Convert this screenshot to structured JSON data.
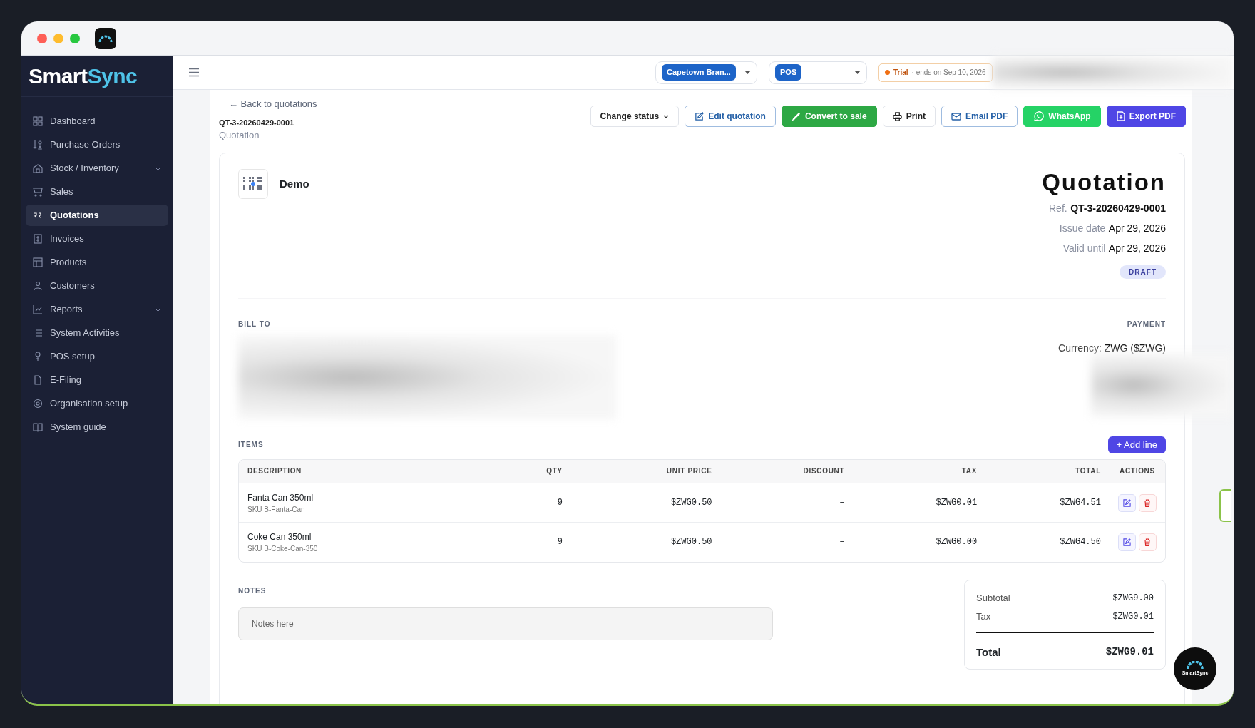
{
  "sidebar": {
    "logo": {
      "first": "Smart",
      "second": "Sync"
    },
    "items": [
      {
        "label": "Dashboard",
        "selected": false,
        "expandable": false
      },
      {
        "label": "Purchase Orders",
        "selected": false,
        "expandable": false
      },
      {
        "label": "Stock / Inventory",
        "selected": false,
        "expandable": true
      },
      {
        "label": "Sales",
        "selected": false,
        "expandable": false
      },
      {
        "label": "Quotations",
        "selected": true,
        "expandable": false
      },
      {
        "label": "Invoices",
        "selected": false,
        "expandable": false
      },
      {
        "label": "Products",
        "selected": false,
        "expandable": false
      },
      {
        "label": "Customers",
        "selected": false,
        "expandable": false
      },
      {
        "label": "Reports",
        "selected": false,
        "expandable": true
      },
      {
        "label": "System Activities",
        "selected": false,
        "expandable": false
      },
      {
        "label": "POS setup",
        "selected": false,
        "expandable": false
      },
      {
        "label": "E-Filing",
        "selected": false,
        "expandable": false
      },
      {
        "label": "Organisation setup",
        "selected": false,
        "expandable": false
      },
      {
        "label": "System guide",
        "selected": false,
        "expandable": false
      }
    ]
  },
  "header": {
    "branch": "Capetown Bran...",
    "register": "POS",
    "trial": {
      "label": "Trial",
      "text": "· ends on Sep 10, 2026"
    }
  },
  "page": {
    "back_link": "← Back to quotations",
    "number": "QT-3-20260429-0001",
    "subtitle": "Quotation"
  },
  "actions": [
    {
      "label": "Change status",
      "kind": "dropdown"
    },
    {
      "label": "Edit quotation",
      "kind": "outline"
    },
    {
      "label": "Convert to sale",
      "kind": "success"
    },
    {
      "label": "Print",
      "kind": "light"
    },
    {
      "label": "Email PDF",
      "kind": "outline"
    },
    {
      "label": "WhatsApp",
      "kind": "whatsapp"
    },
    {
      "label": "Export PDF",
      "kind": "primary"
    }
  ],
  "document": {
    "company": "Demo",
    "title": "Quotation",
    "ref_label": "Ref.",
    "ref": "QT-3-20260429-0001",
    "meta": [
      {
        "label": "Issue date",
        "value": "Apr 29, 2026"
      },
      {
        "label": "Valid until",
        "value": "Apr 29, 2026"
      }
    ],
    "status": "DRAFT",
    "bill_to_label": "BILL TO",
    "payment_label": "PAYMENT",
    "currency_label": "Currency:",
    "currency": "ZWG ($ZWG)"
  },
  "items": {
    "label": "ITEMS",
    "add_button": "+ Add line",
    "columns": [
      "DESCRIPTION",
      "QTY",
      "UNIT PRICE",
      "DISCOUNT",
      "TAX",
      "TOTAL",
      "ACTIONS"
    ],
    "rows": [
      {
        "description": "Fanta Can 350ml",
        "sku": "SKU B-Fanta-Can",
        "qty": "9",
        "unit_price": "$ZWG0.50",
        "discount": "–",
        "tax": "$ZWG0.01",
        "total": "$ZWG4.51"
      },
      {
        "description": "Coke Can 350ml",
        "sku": "SKU B-Coke-Can-350",
        "qty": "9",
        "unit_price": "$ZWG0.50",
        "discount": "–",
        "tax": "$ZWG0.00",
        "total": "$ZWG4.50"
      }
    ]
  },
  "notes": {
    "label": "NOTES",
    "placeholder": "Notes here"
  },
  "summary": {
    "rows": [
      {
        "label": "Subtotal",
        "value": "$ZWG9.00"
      },
      {
        "label": "Tax",
        "value": "$ZWG0.01"
      }
    ],
    "total_label": "Total",
    "total": "$ZWG9.01"
  },
  "chat_bubble": {
    "label": "SmartSync"
  }
}
